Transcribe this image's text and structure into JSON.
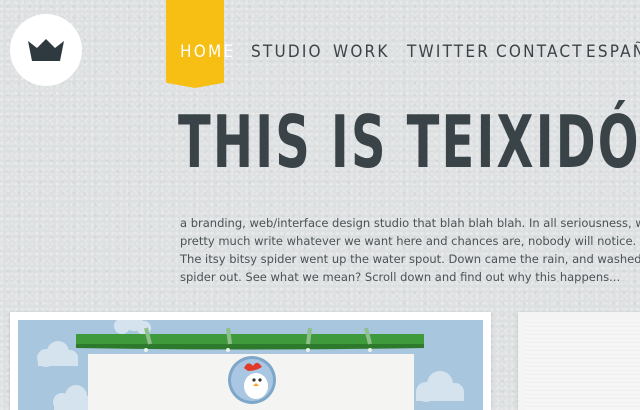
{
  "logo": {
    "icon": "crown-icon"
  },
  "nav": {
    "items": [
      {
        "label": "HOME",
        "active": true
      },
      {
        "label": "STUDIO",
        "active": false
      },
      {
        "label": "WORK",
        "active": false
      },
      {
        "label": "TWITTER",
        "active": false
      },
      {
        "label": "CONTACT",
        "active": false
      },
      {
        "label": "ESPAÑOL",
        "active": false
      }
    ],
    "active_color": "#f7bf13"
  },
  "hero": {
    "title": "THIS IS TEIXIDÓ",
    "lines": [
      "a branding, web/interface design studio that blah blah blah. In all seriousness, we c",
      "pretty much write whatever we want here and chances are, nobody will notice.",
      "The itsy bitsy spider went up the water spout. Down came the rain, and washed the",
      "spider out. See what we mean? Scroll down and find out why this happens..."
    ]
  },
  "cards": {
    "left": {
      "icon": "chicken-icon"
    },
    "right": {}
  }
}
